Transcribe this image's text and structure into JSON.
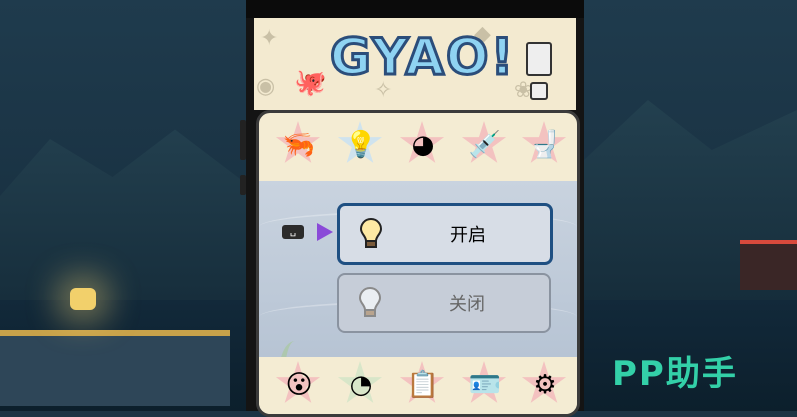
{
  "game": {
    "logo_text": "GYAO!",
    "top_categories": [
      {
        "icon": "shrimp-icon",
        "selected": false
      },
      {
        "icon": "lightbulb-icon",
        "selected": true
      },
      {
        "icon": "beach-ball-icon",
        "selected": false
      },
      {
        "icon": "syringe-icon",
        "selected": false
      },
      {
        "icon": "toilet-icon",
        "selected": false
      }
    ],
    "bottom_categories": [
      {
        "icon": "surprised-face-icon"
      },
      {
        "icon": "pacman-icon"
      },
      {
        "icon": "clipboard-icon"
      },
      {
        "icon": "id-card-icon"
      },
      {
        "icon": "gear-icon"
      }
    ],
    "options": {
      "on_label": "开启",
      "off_label": "关闭"
    },
    "keycap_label": "␣"
  },
  "watermark": "PP助手",
  "colors": {
    "selected_border": "#1e4f82",
    "cursor_arrow": "#8a4ad8",
    "watermark": "#33d0a8"
  }
}
